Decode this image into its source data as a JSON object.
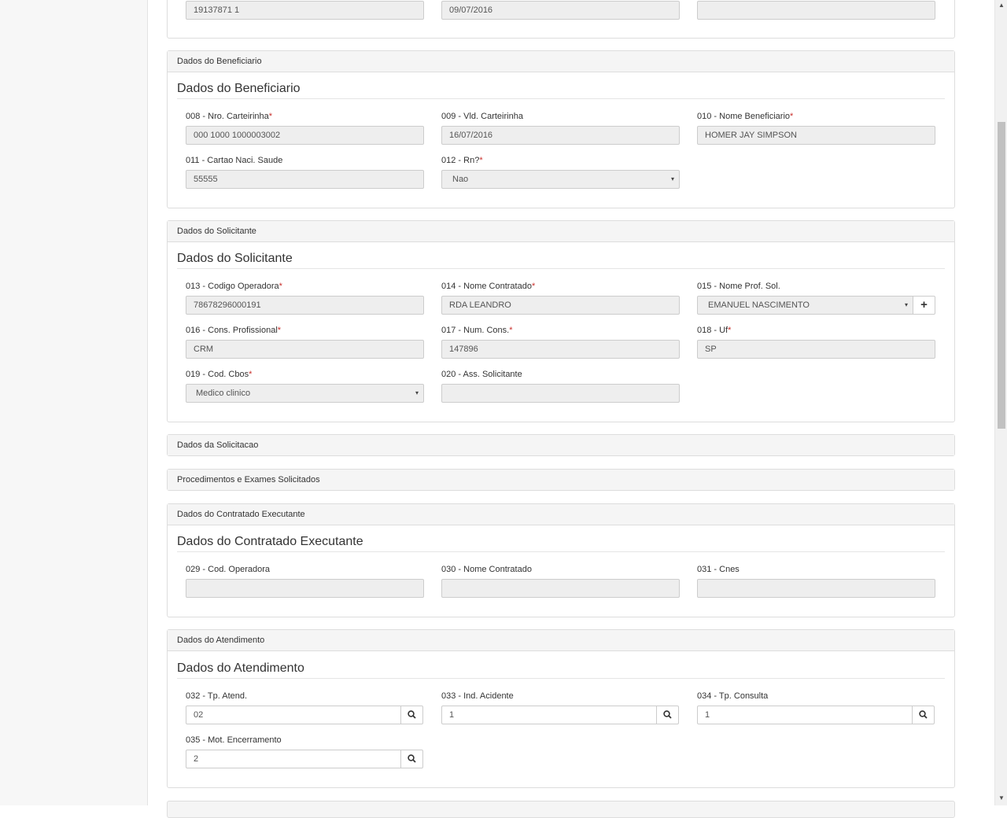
{
  "top_row": {
    "field1_value": "19137871 1",
    "field2_value": "09/07/2016",
    "field3_value": ""
  },
  "beneficiario": {
    "heading": "Dados do Beneficiario",
    "legend": "Dados do Beneficiario",
    "carteirinha_label": "008 - Nro. Carteirinha",
    "carteirinha_value": "000 1000 1000003002",
    "validade_label": "009 - Vld. Carteirinha",
    "validade_value": "16/07/2016",
    "nome_label": "010 - Nome Beneficiario",
    "nome_value": "HOMER JAY SIMPSON",
    "cns_label": "011 - Cartao Naci. Saude",
    "cns_value": "55555",
    "rn_label": "012 - Rn?",
    "rn_value": "Nao"
  },
  "solicitante": {
    "heading": "Dados do Solicitante",
    "legend": "Dados do Solicitante",
    "cod_operadora_label": "013 - Codigo Operadora",
    "cod_operadora_value": "78678296000191",
    "nome_contratado_label": "014 - Nome Contratado",
    "nome_contratado_value": "RDA LEANDRO",
    "prof_sol_label": "015 - Nome Prof. Sol.",
    "prof_sol_value": "EMANUEL NASCIMENTO",
    "cons_prof_label": "016 - Cons. Profissional",
    "cons_prof_value": "CRM",
    "num_cons_label": "017 - Num. Cons.",
    "num_cons_value": "147896",
    "uf_label": "018 - Uf",
    "uf_value": "SP",
    "cbos_label": "019 - Cod. Cbos",
    "cbos_value": "Medico clinico",
    "ass_label": "020 - Ass. Solicitante",
    "ass_value": ""
  },
  "solicitacao": {
    "heading": "Dados da Solicitacao"
  },
  "procedimentos": {
    "heading": "Procedimentos e Exames Solicitados"
  },
  "executante": {
    "heading": "Dados do Contratado Executante",
    "legend": "Dados do Contratado Executante",
    "cod_operadora_label": "029 - Cod. Operadora",
    "cod_operadora_value": "",
    "nome_contratado_label": "030 - Nome Contratado",
    "nome_contratado_value": "",
    "cnes_label": "031 - Cnes",
    "cnes_value": ""
  },
  "atendimento": {
    "heading": "Dados do Atendimento",
    "legend": "Dados do Atendimento",
    "tp_atend_label": "032 - Tp. Atend.",
    "tp_atend_value": "02",
    "ind_acidente_label": "033 - Ind. Acidente",
    "ind_acidente_value": "1",
    "tp_consulta_label": "034 - Tp. Consulta",
    "tp_consulta_value": "1",
    "mot_enc_label": "035 - Mot. Encerramento",
    "mot_enc_value": "2"
  },
  "required_mark": "*",
  "icons": {
    "select_caret": "▾",
    "add": "+",
    "scroll_up": "▲",
    "scroll_down": "▼"
  }
}
